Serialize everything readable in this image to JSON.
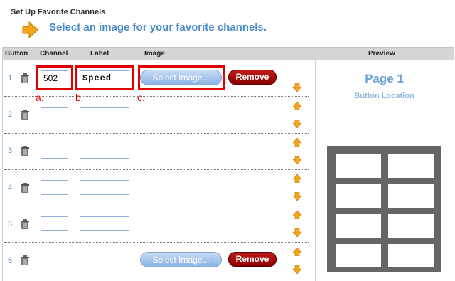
{
  "page": {
    "title": "Set Up Favorite Channels",
    "instruction": "Select an image for your favorite channels."
  },
  "table": {
    "headers": {
      "button": "Button",
      "channel": "Channel",
      "label": "Label",
      "image": "Image",
      "preview": "Preview"
    },
    "rows": [
      {
        "num": "1",
        "channel": "502",
        "label": "Speed",
        "has_image_buttons": true
      },
      {
        "num": "2",
        "channel": "",
        "label": "",
        "has_image_buttons": false
      },
      {
        "num": "3",
        "channel": "",
        "label": "",
        "has_image_buttons": false
      },
      {
        "num": "4",
        "channel": "",
        "label": "",
        "has_image_buttons": false
      },
      {
        "num": "5",
        "channel": "",
        "label": "",
        "has_image_buttons": false
      },
      {
        "num": "6",
        "channel": "",
        "label": "",
        "has_image_buttons": true
      }
    ]
  },
  "buttons": {
    "select_image": "Select Image...",
    "remove": "Remove"
  },
  "callouts": {
    "a": "a.",
    "b": "b.",
    "c": "c."
  },
  "preview": {
    "page": "Page 1",
    "subtitle": "Button Location"
  },
  "icons": {
    "instruction": "arrow-right-icon",
    "delete": "trash-icon",
    "up": "arrow-up-icon",
    "down": "arrow-down-icon"
  },
  "colors": {
    "accent_blue": "#4a8cc9",
    "callout_red": "#e00000",
    "remove_red": "#a30000",
    "arrow_orange": "#f3a31c"
  }
}
